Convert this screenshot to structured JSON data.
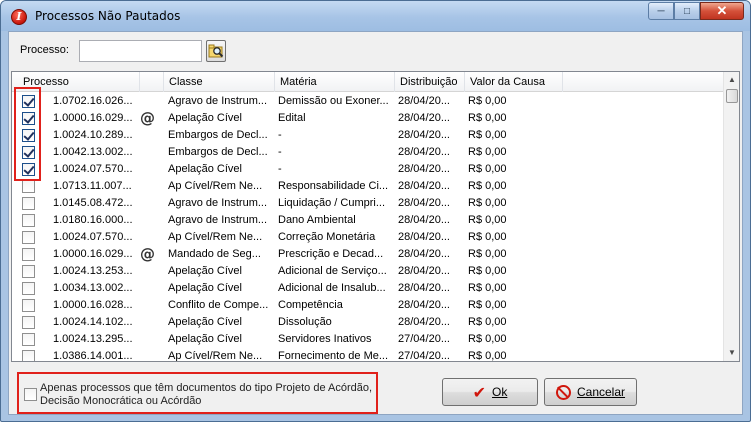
{
  "window": {
    "title": "Processos Não Pautados",
    "app_icon": "I",
    "controls": {
      "minimize": "─",
      "maximize": "□",
      "close": "✕"
    }
  },
  "search": {
    "label": "Processo:",
    "value": "",
    "placeholder": "",
    "button_icon": "search-folder-icon"
  },
  "table": {
    "columns": [
      "Processo",
      "Classe",
      "Matéria",
      "Distribuição",
      "Valor da Causa"
    ],
    "rows": [
      {
        "checked": true,
        "processo": "1.0702.16.026...",
        "doc_icon": false,
        "classe": "Agravo de Instrum...",
        "materia": "Demissão ou Exoner...",
        "distribuicao": "28/04/20...",
        "valor": "R$ 0,00"
      },
      {
        "checked": true,
        "processo": "1.0000.16.029...",
        "doc_icon": true,
        "classe": "Apelação Cível",
        "materia": "Edital",
        "distribuicao": "28/04/20...",
        "valor": "R$ 0,00"
      },
      {
        "checked": true,
        "processo": "1.0024.10.289...",
        "doc_icon": false,
        "classe": "Embargos de Decl...",
        "materia": "-",
        "distribuicao": "28/04/20...",
        "valor": "R$ 0,00"
      },
      {
        "checked": true,
        "processo": "1.0042.13.002...",
        "doc_icon": false,
        "classe": "Embargos de Decl...",
        "materia": "-",
        "distribuicao": "28/04/20...",
        "valor": "R$ 0,00"
      },
      {
        "checked": true,
        "processo": "1.0024.07.570...",
        "doc_icon": false,
        "classe": "Apelação Cível",
        "materia": "-",
        "distribuicao": "28/04/20...",
        "valor": "R$ 0,00"
      },
      {
        "checked": false,
        "processo": "1.0713.11.007...",
        "doc_icon": false,
        "classe": "Ap Cível/Rem Ne...",
        "materia": "Responsabilidade Ci...",
        "distribuicao": "28/04/20...",
        "valor": "R$ 0,00"
      },
      {
        "checked": false,
        "processo": "1.0145.08.472...",
        "doc_icon": false,
        "classe": "Agravo de Instrum...",
        "materia": "Liquidação / Cumpri...",
        "distribuicao": "28/04/20...",
        "valor": "R$ 0,00"
      },
      {
        "checked": false,
        "processo": "1.0180.16.000...",
        "doc_icon": false,
        "classe": "Agravo de Instrum...",
        "materia": "Dano Ambiental",
        "distribuicao": "28/04/20...",
        "valor": "R$ 0,00"
      },
      {
        "checked": false,
        "processo": "1.0024.07.570...",
        "doc_icon": false,
        "classe": "Ap Cível/Rem Ne...",
        "materia": "Correção Monetária",
        "distribuicao": "28/04/20...",
        "valor": "R$ 0,00"
      },
      {
        "checked": false,
        "processo": "1.0000.16.029...",
        "doc_icon": true,
        "classe": "Mandado de Seg...",
        "materia": "Prescrição e Decad...",
        "distribuicao": "28/04/20...",
        "valor": "R$ 0,00"
      },
      {
        "checked": false,
        "processo": "1.0024.13.253...",
        "doc_icon": false,
        "classe": "Apelação Cível",
        "materia": "Adicional de Serviço...",
        "distribuicao": "28/04/20...",
        "valor": "R$ 0,00"
      },
      {
        "checked": false,
        "processo": "1.0034.13.002...",
        "doc_icon": false,
        "classe": "Apelação Cível",
        "materia": "Adicional de Insalub...",
        "distribuicao": "28/04/20...",
        "valor": "R$ 0,00"
      },
      {
        "checked": false,
        "processo": "1.0000.16.028...",
        "doc_icon": false,
        "classe": "Conflito de Compe...",
        "materia": "Competência",
        "distribuicao": "28/04/20...",
        "valor": "R$ 0,00"
      },
      {
        "checked": false,
        "processo": "1.0024.14.102...",
        "doc_icon": false,
        "classe": "Apelação Cível",
        "materia": "Dissolução",
        "distribuicao": "28/04/20...",
        "valor": "R$ 0,00"
      },
      {
        "checked": false,
        "processo": "1.0024.13.295...",
        "doc_icon": false,
        "classe": "Apelação Cível",
        "materia": "Servidores Inativos",
        "distribuicao": "27/04/20...",
        "valor": "R$ 0,00"
      },
      {
        "checked": false,
        "processo": "1.0386.14.001...",
        "doc_icon": false,
        "classe": "Ap Cível/Rem Ne...",
        "materia": "Fornecimento de Me...",
        "distribuicao": "27/04/20...",
        "valor": "R$ 0,00"
      }
    ]
  },
  "footer": {
    "filter_checked": false,
    "filter_label": "Apenas processos que têm documentos do tipo Projeto de Acórdão, Decisão Monocrática ou Acórdão",
    "ok_label": "Ok",
    "cancel_label": "Cancelar"
  },
  "colors": {
    "highlight": "#e0211b",
    "accent_red": "#d0160c",
    "titlebar": "#a7c4e6"
  }
}
